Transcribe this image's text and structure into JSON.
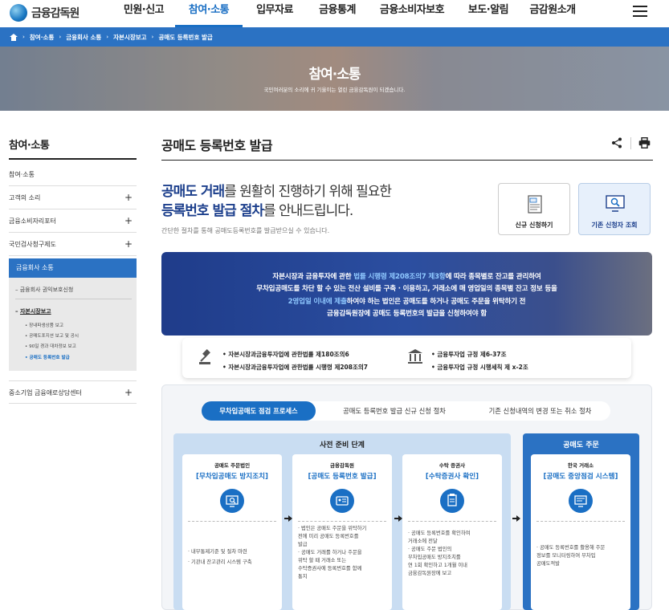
{
  "header": {
    "logo_text": "금융감독원",
    "nav": [
      {
        "label": "민원·신고",
        "active": false
      },
      {
        "label": "참여·소통",
        "active": true
      },
      {
        "label": "입무자료",
        "active": false
      },
      {
        "label": "금융통계",
        "active": false
      },
      {
        "label": "금융소비자보호",
        "active": false
      },
      {
        "label": "보도·알림",
        "active": false
      },
      {
        "label": "금감원소개",
        "active": false
      }
    ]
  },
  "breadcrumb": [
    "참여·소통",
    "금융회사 소통",
    "자본시장보고",
    "공매도 등록번호 발급"
  ],
  "banner": {
    "title": "참여·소통",
    "subtitle": "국민여러분의 소리에 귀 기울이는 열린 금융감독원이 되겠습니다."
  },
  "sidebar": {
    "title": "참여·소통",
    "items": [
      {
        "label": "참여·소통",
        "plus": ""
      },
      {
        "label": "고객의 소리",
        "plus": "+"
      },
      {
        "label": "금융소비자리포터",
        "plus": "+"
      },
      {
        "label": "국민검사청구제도",
        "plus": "+"
      }
    ],
    "active": "금융회사 소통",
    "sub": [
      {
        "label": "금융회사 권익보호신청",
        "bold": false
      },
      {
        "label": "자본시장보고",
        "bold": true
      }
    ],
    "subsub": [
      {
        "label": "장내파생상품 보고",
        "active": false
      },
      {
        "label": "공매도포지션 보고 및 공시",
        "active": false
      },
      {
        "label": "90일 경과 대차정보 보고",
        "active": false
      },
      {
        "label": "공매도 등록번호 발급",
        "active": true
      }
    ],
    "last_item": {
      "label": "중소기업 금융애로상담센터",
      "plus": "+"
    }
  },
  "main": {
    "title": "공매도 등록번호 발급",
    "intro_line1_bold": "공매도 거래",
    "intro_line1_rest": "를 원활히 진행하기 위해 필요한",
    "intro_line2_bold": "등록번호 발급 절차",
    "intro_line2_rest": "를 안내드립니다.",
    "intro_sub": "간단한 절차를 통해 공매도등록번호를 발급받으실 수 있습니다.",
    "btn_new": "신규 신청하기",
    "btn_search": "기존 신청자 조회",
    "info": {
      "l1_a": "자본시장과 금융투자에 관한 ",
      "l1_b": "법률 시행령 제208조의7 제3항",
      "l1_c": "에 따라 종목별로 잔고를 관리하여",
      "l2": "무차입공매도를 차단 할 수 있는 전산 설비를 구축 · 이용하고, 거래소에 매 영업일의 종목별 잔고 정보 등을",
      "l3_a": "2영업일 이내에 제출",
      "l3_b": "하여야 하는 법인은 공매도를 하거나 공매도 주문을 위탁하기 전",
      "l4": "금융감독원장에 공매도 등록번호의 발급을 신청하여야 함"
    },
    "laws": [
      "자본시장과금융투자업에 관한법률 제180조의6",
      "자본시장과금융투자업에 관한법률 시행령 제208조의7",
      "금융투자업 규정 제6-37조",
      "금융투자업 규정 시행세칙 제 x-2조"
    ],
    "tabs": [
      "무차입공매도 점검 프로세스",
      "공매도 등록번호 발급 신규 신청 절차",
      "기존 신청내역의 변경 또는 취소 절차"
    ],
    "prep_title": "사전 준비 단계",
    "order_title": "공매도 주문",
    "cards": [
      {
        "inst": "공매도 주문법인",
        "name": "[무차입공매도 방지조치]",
        "text": [
          "· 내부통제기준 및 절차 마련",
          "· 기관내 잔고관리 시스템 구축"
        ]
      },
      {
        "inst": "금융감독원",
        "name": "[공매도 등록번호 발급]",
        "text": [
          "· 법인은 공매도 주문을 위탁하기",
          "  전에 미리 공매도 등록번호를",
          "  발급",
          "· 공매도 거래를 하거나 주문을",
          "  위탁 할 때 거래소 또는",
          "  수탁증권사에 등록번호를 함께",
          "  통지"
        ]
      },
      {
        "inst": "수탁 증권사",
        "name": "[수탁증권사 확인]",
        "text": [
          "· 공매도 등록번호를 확인하여",
          "  거래소에 전달",
          "· 공매도 주문 법인의",
          "  무차입공매도 방지조치를",
          "  연 1회 확인하고 1개월 이내",
          "  금융감독원장에 보고"
        ]
      },
      {
        "inst": "한국 거래소",
        "name": "[공매도 중앙점검 시스템]",
        "text": [
          "· 공매도 등록번호를 활용해 주문",
          "  정보를 모니터링하여 무차입",
          "  공매도적발"
        ]
      }
    ],
    "colors": {
      "primary": "#1a6fc4",
      "navy": "#1c3f8c",
      "breadcrumb": "#2b72c3"
    }
  }
}
